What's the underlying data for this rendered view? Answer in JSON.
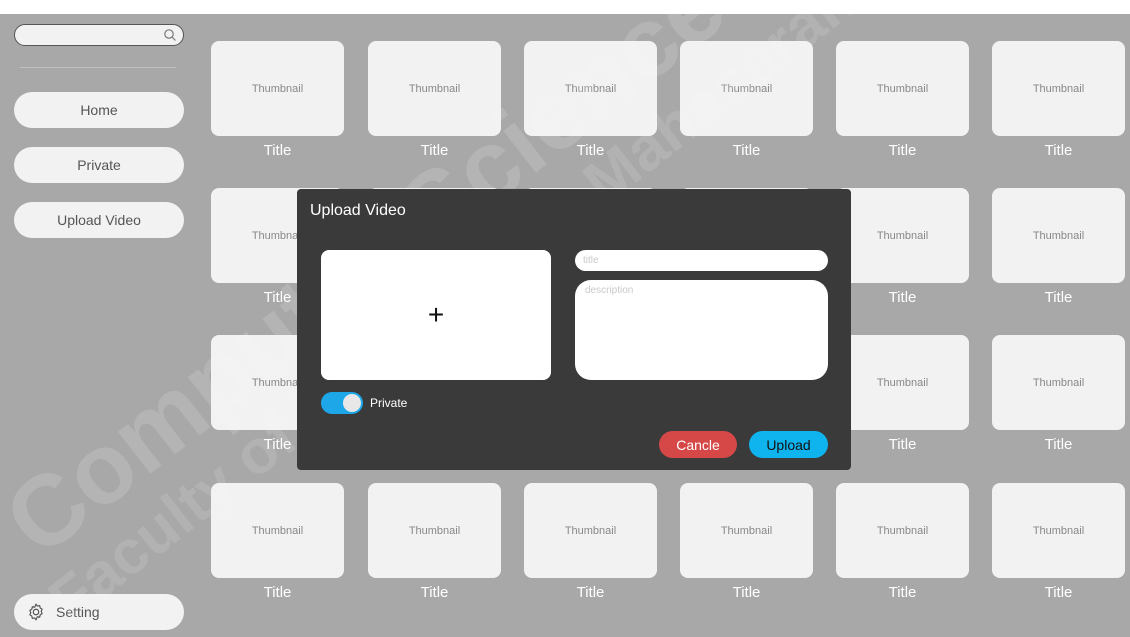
{
  "sidebar": {
    "search_placeholder": "",
    "items": [
      {
        "label": "Home"
      },
      {
        "label": "Private"
      },
      {
        "label": "Upload Video"
      }
    ],
    "setting_label": "Setting"
  },
  "grid": {
    "thumbnail_label": "Thumbnail",
    "title_label": "Title",
    "rows": 4,
    "columns": 6
  },
  "modal": {
    "title": "Upload Video",
    "title_placeholder": "title",
    "description_placeholder": "description",
    "private_label": "Private",
    "private_enabled": true,
    "cancel_label": "Cancle",
    "upload_label": "Upload"
  },
  "watermark": {
    "line1": "Computer Science",
    "line2": "Faculty of Informatics, Mahasarakham"
  },
  "colors": {
    "background": "#a8a8a8",
    "card": "#f2f2f2",
    "modal": "#3a3a3a",
    "cancel": "#d64848",
    "upload": "#0fb4ee",
    "toggle": "#1ea7e8"
  }
}
